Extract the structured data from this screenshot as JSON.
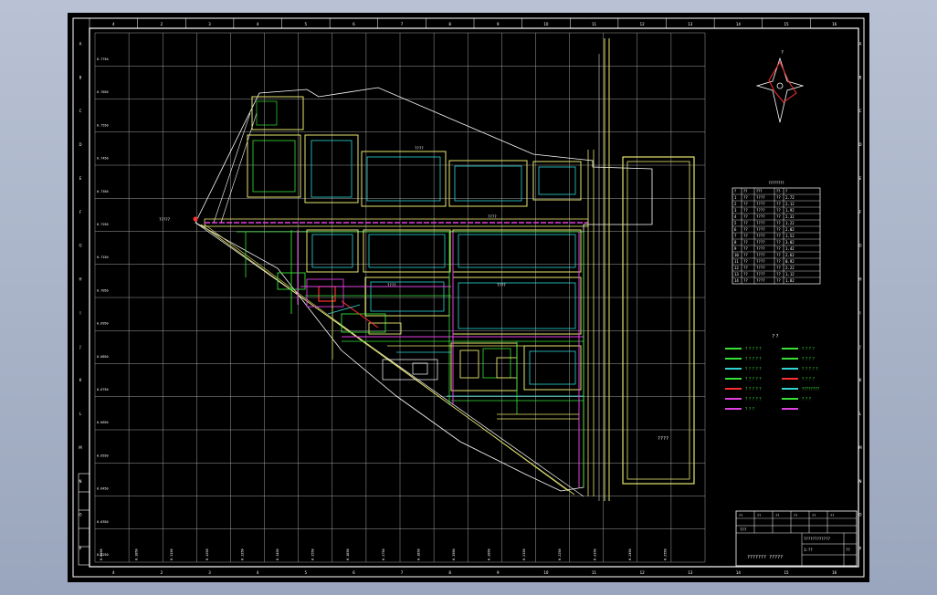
{
  "colors": {
    "background": "#000000",
    "frame": "#ffffff",
    "grid": "#ffffff",
    "boundary": "#ffffff",
    "road": "#e6e66e",
    "building": "#2fd5d5",
    "green": "#37e037",
    "magenta": "#e040e0",
    "red": "#ff3030",
    "yellow": "#f0f040"
  },
  "top_ruler": [
    "4",
    "2",
    "3",
    "4",
    "5",
    "6",
    "7",
    "8",
    "9",
    "10",
    "11",
    "12",
    "13",
    "14",
    "15",
    "16"
  ],
  "left_ruler": [
    "A",
    "B",
    "C",
    "D",
    "E",
    "F",
    "G",
    "H",
    "I",
    "J",
    "K",
    "L",
    "M",
    "N",
    "O",
    "P"
  ],
  "left_coords": [
    "0.7750",
    "0.7650",
    "0.7550",
    "0.7450",
    "0.7350",
    "0.7250",
    "0.7150",
    "0.7050",
    "0.6950",
    "0.6850",
    "0.6750",
    "0.6650",
    "0.6550",
    "0.6450",
    "0.6350",
    "0.6250"
  ],
  "bottom_coords": [
    "0.0950",
    "0.1050",
    "0.1150",
    "0.1250",
    "0.1350",
    "0.1450",
    "0.1550",
    "0.1650",
    "0.1750",
    "0.1850",
    "0.1950",
    "0.2050",
    "0.2150",
    "0.2250",
    "0.2350",
    "0.2450",
    "0.2550"
  ],
  "site_label": "?????",
  "field_label": "????",
  "parcel_labels": [
    "????",
    "????",
    "????",
    "????"
  ],
  "table": {
    "title": "????????",
    "headers": [
      "?",
      "??",
      "???",
      "??",
      "?"
    ],
    "rows": [
      [
        "1",
        "??",
        "????",
        "??",
        "2.72"
      ],
      [
        "2",
        "??",
        "????",
        "??",
        "2.12"
      ],
      [
        "3",
        "??",
        "????",
        "??",
        "1.92"
      ],
      [
        "4",
        "??",
        "????",
        "??",
        "2.32"
      ],
      [
        "5",
        "??",
        "????",
        "??",
        "1.22"
      ],
      [
        "6",
        "??",
        "????",
        "??",
        "2.02"
      ],
      [
        "7",
        "??",
        "????",
        "??",
        "1.52"
      ],
      [
        "8",
        "??",
        "????",
        "??",
        "3.02"
      ],
      [
        "9",
        "??",
        "????",
        "??",
        "1.42"
      ],
      [
        "10",
        "??",
        "????",
        "??",
        "2.62"
      ],
      [
        "11",
        "??",
        "????",
        "??",
        "0.92"
      ],
      [
        "12",
        "??",
        "????",
        "??",
        "2.22"
      ],
      [
        "13",
        "??",
        "????",
        "??",
        "1.12"
      ],
      [
        "14",
        "??",
        "????",
        "??",
        "1.82"
      ]
    ]
  },
  "legend": {
    "title": "? ?",
    "items": [
      {
        "label": "? ? ? ? ?",
        "color": "#37e037"
      },
      {
        "label": "? ? ? ? ?",
        "color": "#37e037"
      },
      {
        "label": "? ? ? ? ?",
        "color": "#2fd5d5"
      },
      {
        "label": "? ? ? ? ?",
        "color": "#37e037"
      },
      {
        "label": "? ? ? ? ?",
        "color": "#ff3030"
      },
      {
        "label": "? ? ? ? ?",
        "color": "#e040e0"
      },
      {
        "label": "?   ?   ?",
        "color": "#e040e0"
      },
      {
        "label": "? ? ? ?",
        "color": "#37e037"
      },
      {
        "label": "? ? ? ?",
        "color": "#37e037"
      },
      {
        "label": "? ? ? ? ?",
        "color": "#2fd5d5"
      },
      {
        "label": "? ? ? ?",
        "color": "#ff3030"
      },
      {
        "label": "????????",
        "color": "#2fd5d5"
      },
      {
        "label": "? ? ?",
        "color": "#37e037"
      },
      {
        "label": "",
        "color": "#e040e0"
      }
    ]
  },
  "north_arrow": "?",
  "title_block": {
    "project": "???",
    "drawing_title": "????????????",
    "main_label": "??????? ?????",
    "cells": [
      "??",
      "??",
      "??",
      "??",
      "??",
      "??"
    ],
    "scale": "1:??",
    "sheet": "??"
  }
}
